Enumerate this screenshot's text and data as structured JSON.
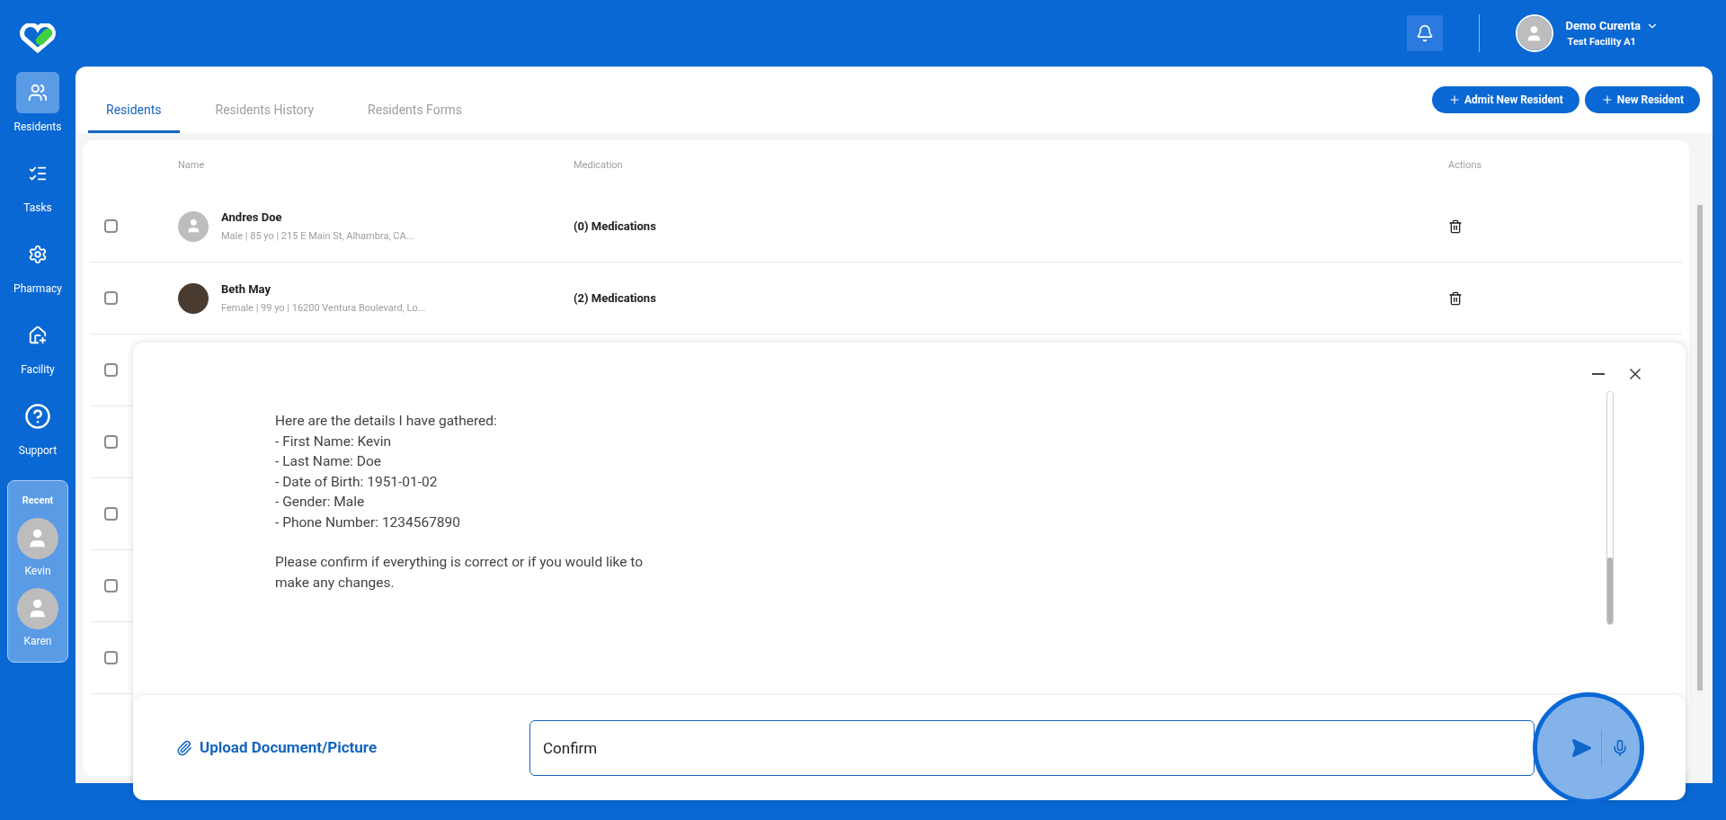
{
  "sidebar": {
    "items": [
      {
        "label": "Residents",
        "selected": true
      },
      {
        "label": "Tasks",
        "selected": false
      },
      {
        "label": "Pharmacy",
        "selected": false
      },
      {
        "label": "Facility",
        "selected": false
      },
      {
        "label": "Support",
        "selected": false
      }
    ],
    "recent": {
      "title": "Recent",
      "people": [
        "Kevin",
        "Karen"
      ]
    }
  },
  "header": {
    "user_name": "Demo Curenta",
    "facility": "Test Facility A1"
  },
  "tabs": [
    {
      "label": "Residents",
      "selected": true
    },
    {
      "label": "Residents History",
      "selected": false
    },
    {
      "label": "Residents Forms",
      "selected": false
    }
  ],
  "actions": [
    "Admit New Resident",
    "New Resident"
  ],
  "table": {
    "columns": [
      "Name",
      "Medication",
      "Actions"
    ],
    "rows": [
      {
        "checked": false,
        "name": "Andres Doe",
        "details": "Male | 85 yo | 215 E Main St, Alhambra, CA...",
        "photo": false,
        "medication": "(0) Medications"
      },
      {
        "checked": false,
        "name": "Beth May",
        "details": "Female | 99 yo | 16200 Ventura Boulevard, Lo...",
        "photo": true,
        "medication": "(2) Medications"
      }
    ],
    "hidden_rows": [
      {
        "checked": false
      },
      {
        "checked": false
      },
      {
        "checked": false
      },
      {
        "checked": false
      },
      {
        "checked": false
      }
    ]
  },
  "chat": {
    "message": [
      "Here are the details I have gathered:\n- First Name: Kevin\n- Last Name: Doe\n- Date of Birth: 1951-01-02\n- Gender: Male\n- Phone Number: 1234567890",
      "Please confirm if everything is correct or if you would like to\nmake any changes."
    ],
    "upload_label": "Upload Document/Picture",
    "input_value": "Confirm"
  }
}
